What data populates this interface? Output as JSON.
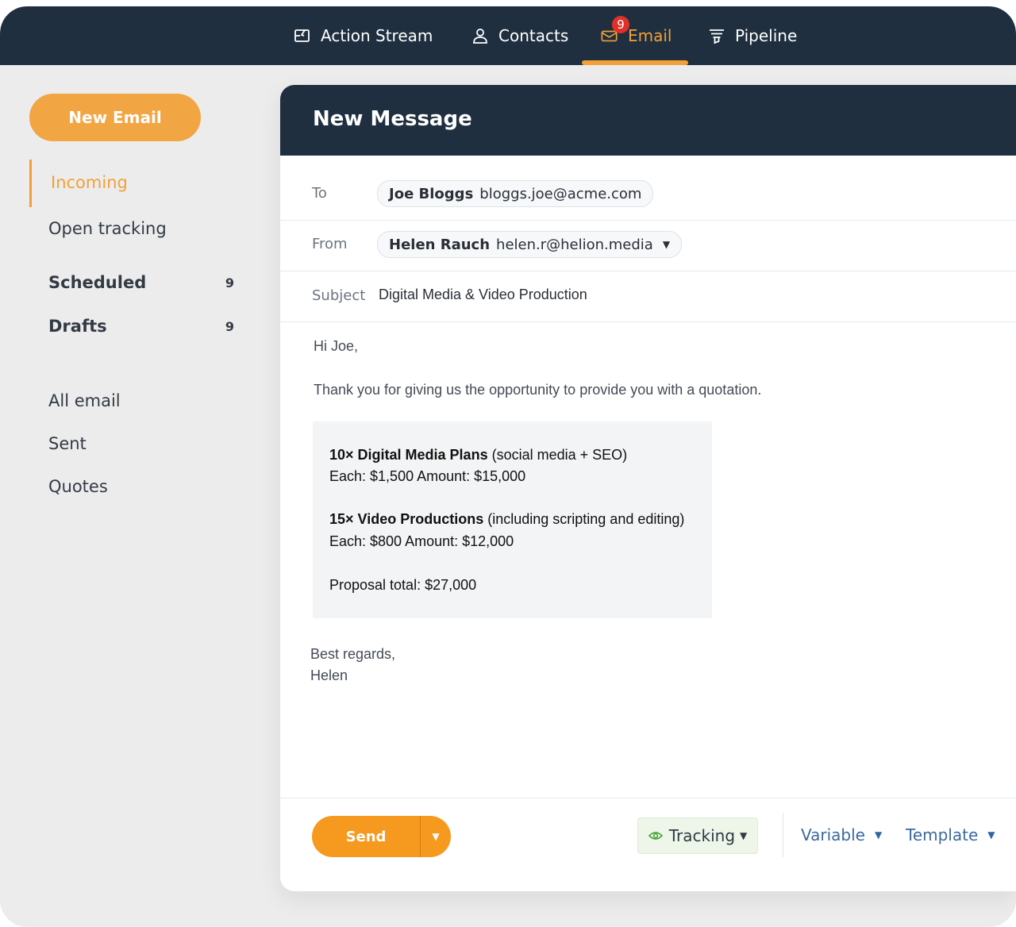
{
  "nav": {
    "items": [
      {
        "label": "Action Stream",
        "icon": "action-stream-icon"
      },
      {
        "label": "Contacts",
        "icon": "user-icon"
      },
      {
        "label": "Email",
        "icon": "envelope-icon",
        "badge": "9"
      },
      {
        "label": "Pipeline",
        "icon": "funnel-icon"
      }
    ]
  },
  "sidebar": {
    "new_email": "New Email",
    "items": [
      {
        "label": "Incoming"
      },
      {
        "label": "Open tracking"
      },
      {
        "label": "Scheduled",
        "count": "9"
      },
      {
        "label": "Drafts",
        "count": "9"
      },
      {
        "label": "All email"
      },
      {
        "label": "Sent"
      },
      {
        "label": "Quotes"
      }
    ]
  },
  "compose": {
    "title": "New Message",
    "to_label": "To",
    "to_name": "Joe Bloggs",
    "to_email": "bloggs.joe@acme.com",
    "from_label": "From",
    "from_name": "Helen Rauch",
    "from_email": "helen.r@helion.media",
    "subject_label": "Subject",
    "subject_value": "Digital Media & Video Production",
    "body": {
      "greeting": "Hi Joe,",
      "intro": "Thank you for giving us the opportunity to provide you with a quotation.",
      "quote": {
        "item1_title": "10× Digital Media Plans",
        "item1_desc": " (social media + SEO)",
        "item1_price": "Each: $1,500  Amount: $15,000",
        "item2_title": "15× Video Productions",
        "item2_desc": " (including scripting and editing)",
        "item2_price": "Each: $800  Amount: $12,000",
        "total": "Proposal total: $27,000"
      },
      "closing": "Best regards,",
      "signature": "Helen"
    }
  },
  "footer": {
    "send": "Send",
    "tracking": "Tracking",
    "variable": "Variable",
    "template": "Template"
  },
  "colors": {
    "navy": "#1f2f3f",
    "accent": "#f2a037",
    "send": "#f59a1f",
    "link": "#3c6a9c",
    "badge": "#e0302a"
  }
}
